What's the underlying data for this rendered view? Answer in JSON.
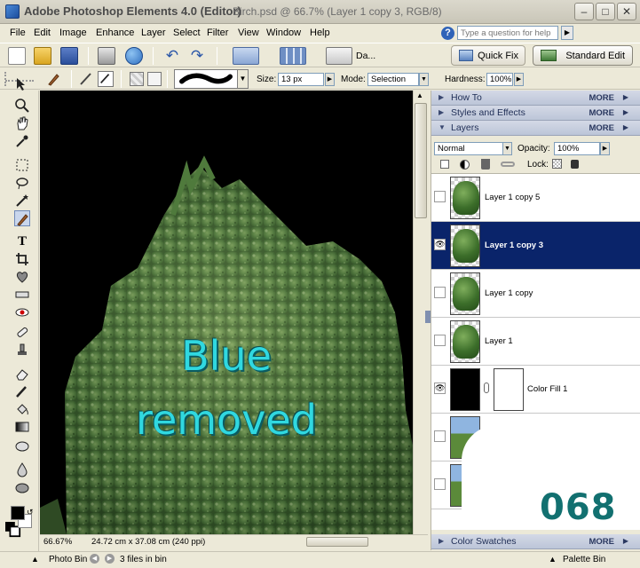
{
  "window": {
    "app_title": "Adobe Photoshop Elements 4.0 (Editor)",
    "doc_title": "Birch.psd @ 66.7% (Layer 1 copy 3, RGB/8)"
  },
  "menu": [
    "File",
    "Edit",
    "Image",
    "Enhance",
    "Layer",
    "Select",
    "Filter",
    "View",
    "Window",
    "Help"
  ],
  "help": {
    "placeholder": "Type a question for help"
  },
  "toolbar": {
    "date_label": "Da...",
    "quick_fix": "Quick Fix",
    "standard_edit": "Standard Edit"
  },
  "options": {
    "size_label": "Size:",
    "size_value": "13 px",
    "mode_label": "Mode:",
    "mode_value": "Selection",
    "hardness_label": "Hardness:",
    "hardness_value": "100%"
  },
  "canvas": {
    "line1": "Blue",
    "line2": "removed"
  },
  "status": {
    "zoom": "66.67%",
    "dims": "24.72 cm x 37.08 cm (240 ppi)"
  },
  "bottom": {
    "photo_bin": "Photo Bin",
    "files": "3 files in bin",
    "palette_bin": "Palette Bin"
  },
  "palettes": {
    "how_to": "How To",
    "styles": "Styles and Effects",
    "layers": "Layers",
    "color_swatches": "Color Swatches",
    "more": "MORE"
  },
  "layers": {
    "blend_mode": "Normal",
    "opacity_label": "Opacity:",
    "opacity_value": "100%",
    "lock_label": "Lock:",
    "items": [
      {
        "name": "Layer 1 copy 5",
        "visible": false,
        "selected": false
      },
      {
        "name": "Layer 1 copy 3",
        "visible": true,
        "selected": true
      },
      {
        "name": "Layer 1 copy",
        "visible": false,
        "selected": false
      },
      {
        "name": "Layer 1",
        "visible": false,
        "selected": false
      },
      {
        "name": "Color Fill 1",
        "visible": true,
        "selected": false
      }
    ]
  },
  "overlay_number": "068",
  "colors": {
    "selection": "#0a246a",
    "overlay_text": "#30d8e0",
    "overlay_number": "#127070"
  }
}
